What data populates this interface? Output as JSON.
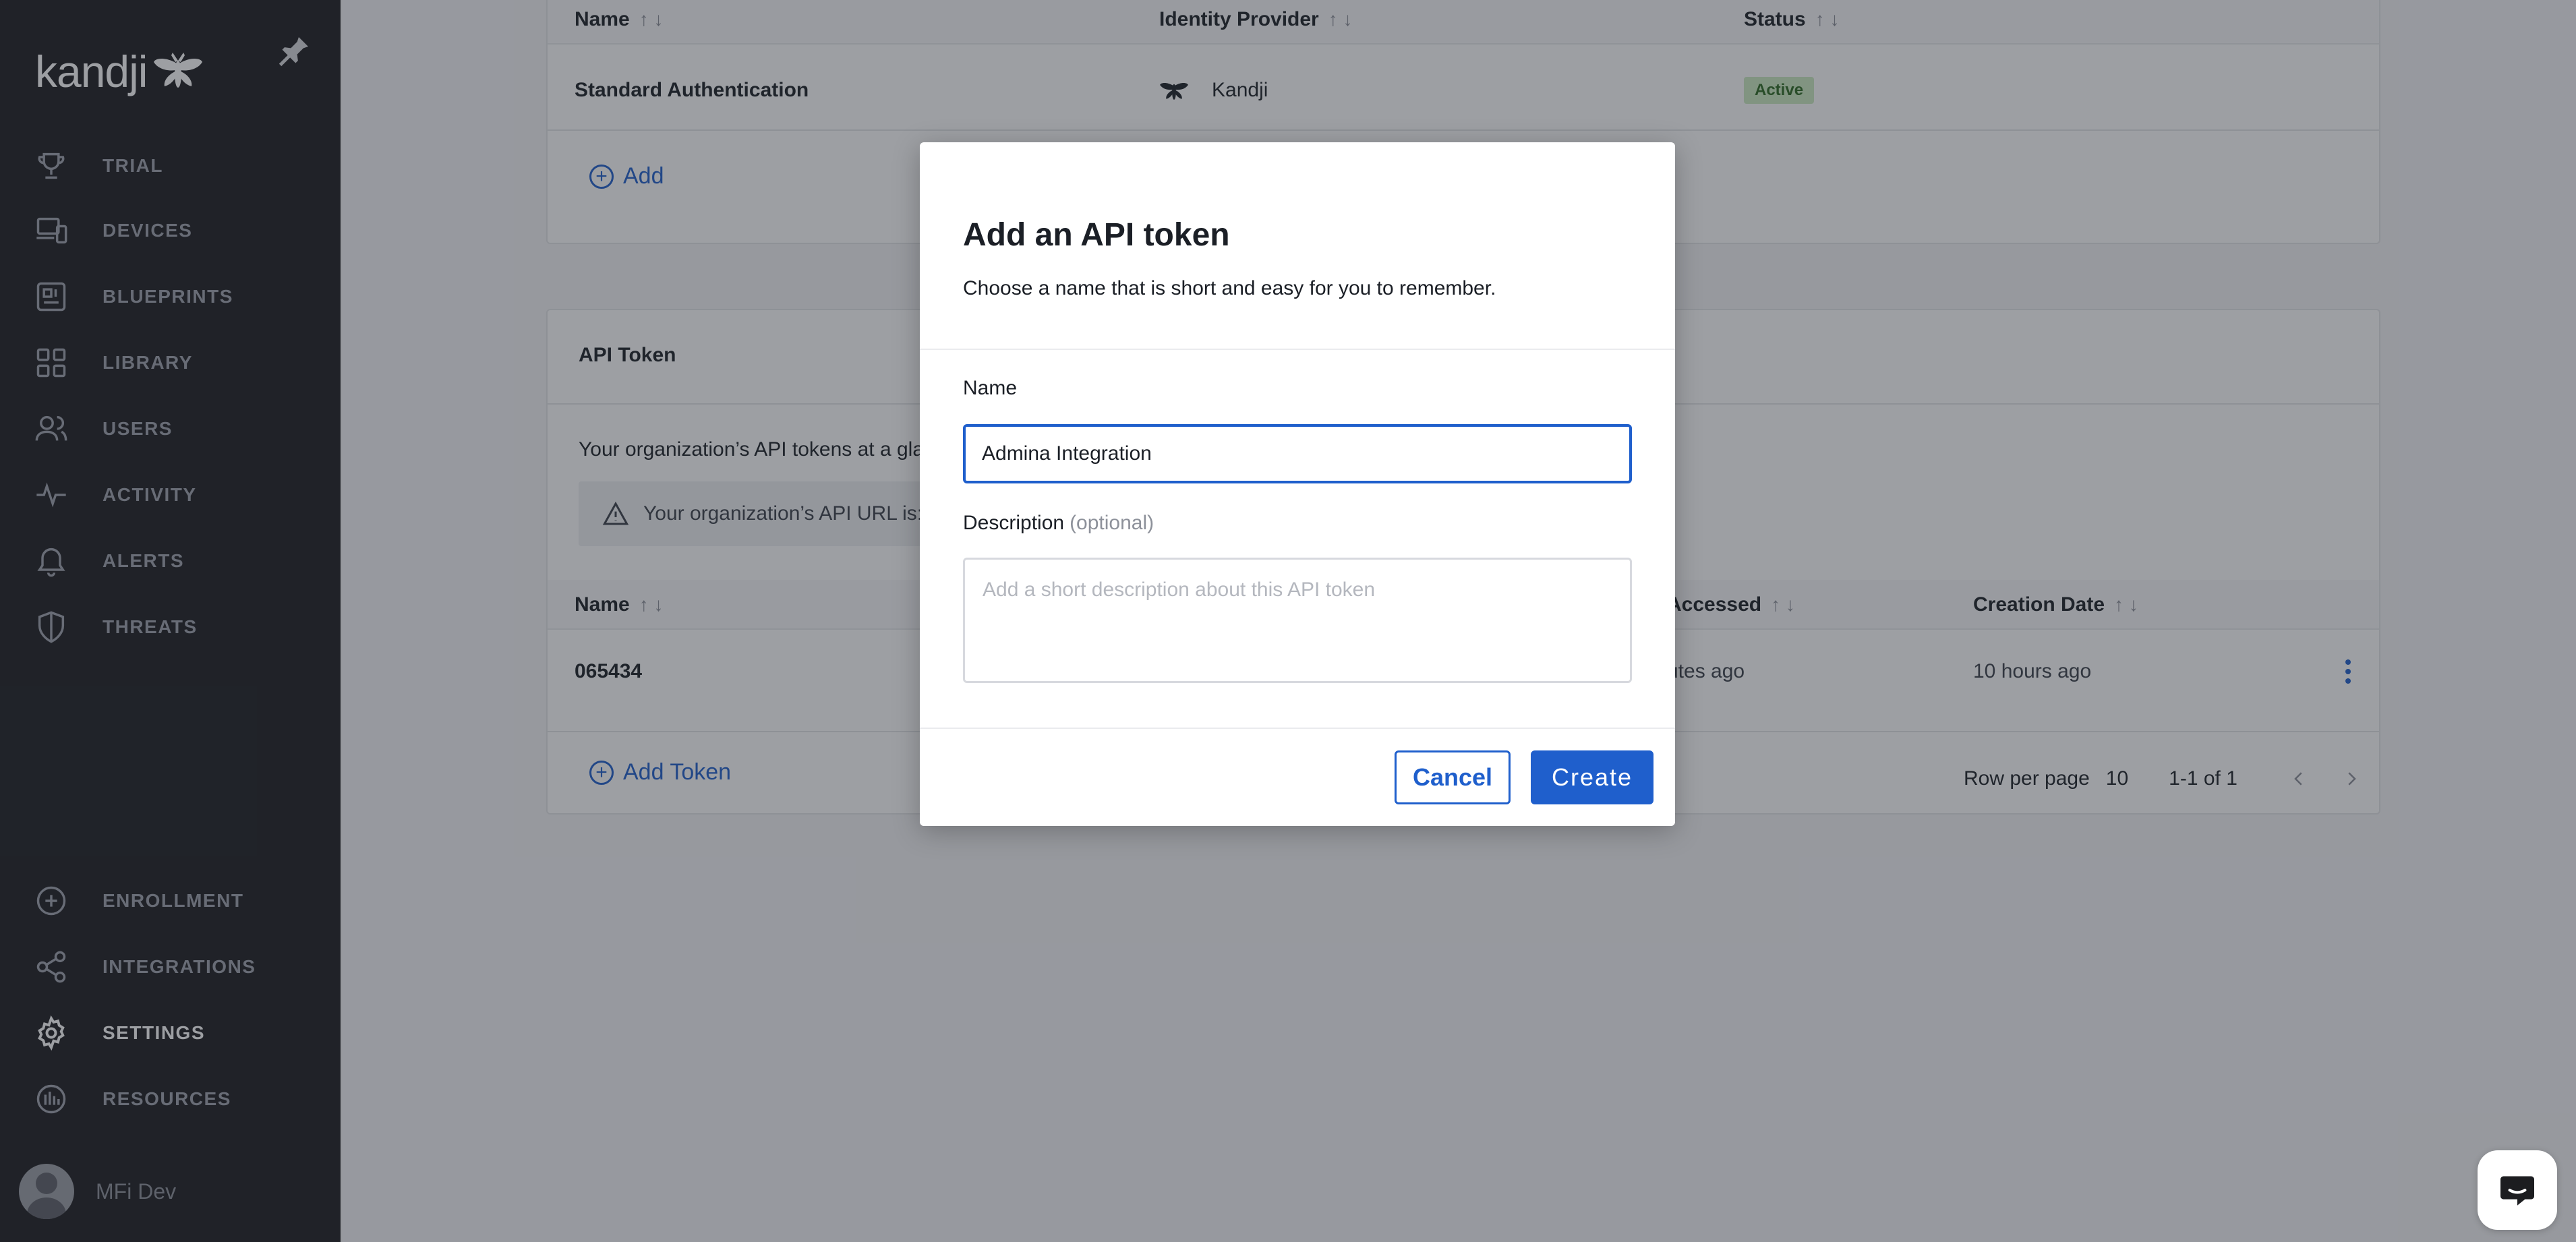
{
  "sidebar": {
    "logo_text": "kandji",
    "items": [
      {
        "label": "TRIAL",
        "icon": "trophy-icon"
      },
      {
        "label": "DEVICES",
        "icon": "devices-icon"
      },
      {
        "label": "BLUEPRINTS",
        "icon": "blueprint-icon"
      },
      {
        "label": "LIBRARY",
        "icon": "library-grid-icon"
      },
      {
        "label": "USERS",
        "icon": "users-icon"
      },
      {
        "label": "ACTIVITY",
        "icon": "activity-pulse-icon"
      },
      {
        "label": "ALERTS",
        "icon": "bell-icon"
      },
      {
        "label": "THREATS",
        "icon": "shield-icon"
      }
    ],
    "bottom_items": [
      {
        "label": "ENROLLMENT",
        "icon": "plus-circle-icon"
      },
      {
        "label": "INTEGRATIONS",
        "icon": "share-nodes-icon"
      },
      {
        "label": "SETTINGS",
        "icon": "gear-icon"
      },
      {
        "label": "RESOURCES",
        "icon": "resources-icon"
      }
    ],
    "active": "SETTINGS",
    "user_name": "MFi Dev"
  },
  "auth_table": {
    "columns": [
      "Name",
      "Identity Provider",
      "Status"
    ],
    "rows": [
      {
        "name": "Standard Authentication",
        "provider": "Kandji",
        "status": "Active"
      }
    ],
    "add_label": "Add"
  },
  "api_token_section": {
    "title": "API Token",
    "intro_text": "Your organization’s API tokens at a glan",
    "notice_text": "Your organization’s API URL is: r",
    "columns": [
      "Name",
      "Accessed",
      "Creation Date"
    ],
    "rows": [
      {
        "name": "065434",
        "accessed": "utes ago",
        "created": "10 hours ago"
      }
    ],
    "add_label": "Add Token",
    "pagination": {
      "rows_label": "Row per page",
      "rows_value": "10",
      "range": "1-1 of 1"
    }
  },
  "modal": {
    "title": "Add an API token",
    "subtitle": "Choose a name that is short and easy for you to remember.",
    "name_label": "Name",
    "name_value": "Admina Integration",
    "description_label": "Description",
    "description_optional": "(optional)",
    "description_placeholder": "Add a short description about this API token",
    "cancel_label": "Cancel",
    "create_label": "Create"
  },
  "colors": {
    "accent": "#1f5fcc",
    "sidebar_bg": "#1c1d20",
    "badge_bg": "#cdebc2"
  }
}
